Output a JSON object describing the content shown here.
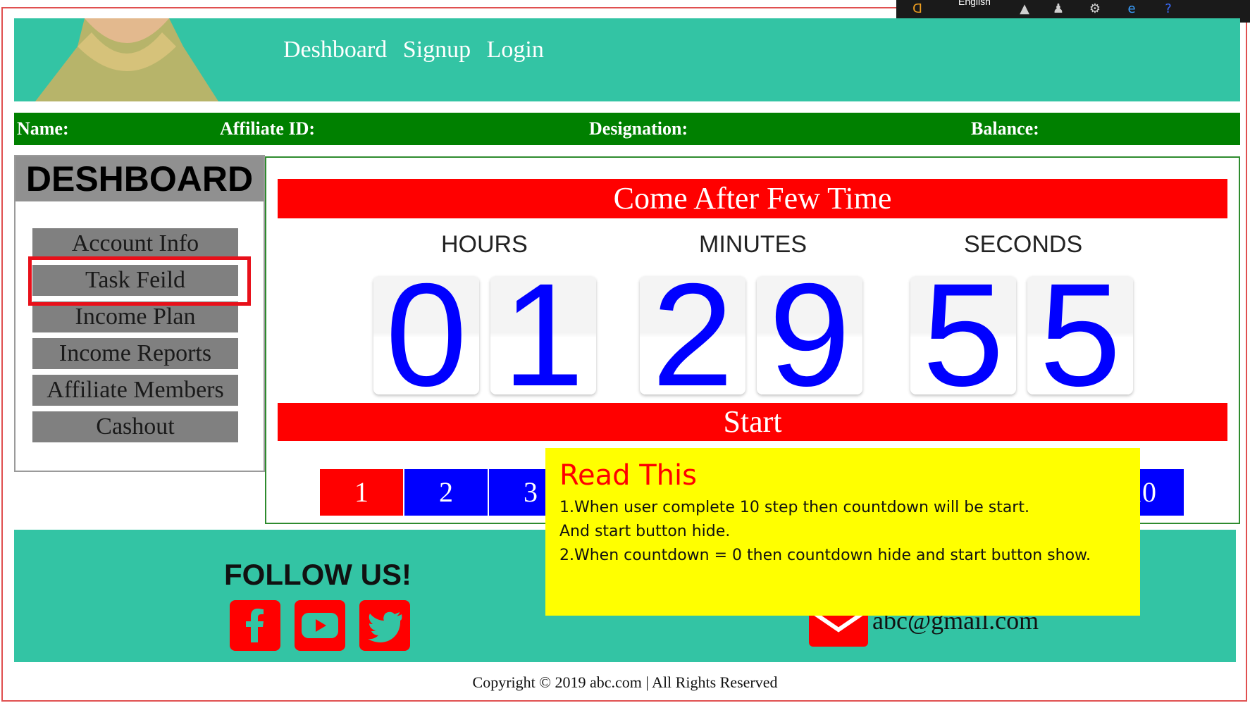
{
  "taskbar": {
    "language": "English"
  },
  "header": {
    "nav": [
      "Deshboard",
      "Signup",
      "Login"
    ]
  },
  "infobar": {
    "name": "Name:",
    "affiliate_id": "Affiliate ID:",
    "designation": "Designation:",
    "balance": "Balance:"
  },
  "sidebar": {
    "title": "DESHBOARD",
    "items": [
      "Account Info",
      "Task Feild",
      "Income Plan",
      "Income Reports",
      "Affiliate Members",
      "Cashout"
    ]
  },
  "main": {
    "banner": "Come After Few Time",
    "labels": {
      "hours": "HOURS",
      "minutes": "MINUTES",
      "seconds": "SECONDS"
    },
    "digits": [
      "0",
      "1",
      "2",
      "9",
      "5",
      "5"
    ],
    "start_label": "Start",
    "steps": [
      "1",
      "2",
      "3",
      "10"
    ]
  },
  "footer": {
    "follow": "FOLLOW US!",
    "email": "abc@gmail.com",
    "copyright": "Copyright © 2019 abc.com | All Rights Reserved"
  },
  "note": {
    "title": "Read This",
    "lines": [
      "1.When user complete 10 step then countdown will be start.",
      "And start button hide.",
      "2.When countdown = 0 then countdown hide and start  button show."
    ]
  },
  "colors": {
    "teal": "#33c4a4",
    "green": "#008000",
    "red": "#ff0000",
    "blue": "#0000ff",
    "yellow": "#ffff00"
  }
}
